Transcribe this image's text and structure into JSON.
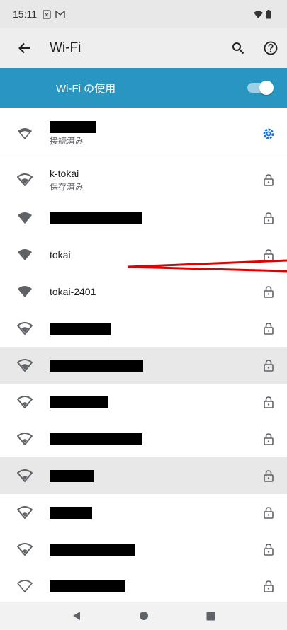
{
  "status_bar": {
    "time": "15:11"
  },
  "app_bar": {
    "title": "Wi-Fi"
  },
  "master_switch": {
    "label": "Wi-Fi の使用",
    "enabled": true,
    "accent": "#2896c0"
  },
  "networks": [
    {
      "name": "",
      "status": "接続済み",
      "redacted": true,
      "secured": false,
      "connected": true,
      "signal": "full-outline"
    },
    {
      "name": "k-tokai",
      "status": "保存済み",
      "redacted": false,
      "secured": true,
      "signal": "outline"
    },
    {
      "name": "",
      "redacted": true,
      "secured": true,
      "signal": "full"
    },
    {
      "name": "tokai",
      "redacted": false,
      "secured": true,
      "signal": "full"
    },
    {
      "name": "tokai-2401",
      "redacted": false,
      "secured": true,
      "signal": "full"
    },
    {
      "name": "",
      "redacted": true,
      "secured": true,
      "signal": "outline"
    },
    {
      "name": "",
      "redacted": true,
      "secured": true,
      "signal": "outline",
      "highlighted": true
    },
    {
      "name": "",
      "redacted": true,
      "secured": true,
      "signal": "outline"
    },
    {
      "name": "",
      "redacted": true,
      "secured": true,
      "signal": "outline"
    },
    {
      "name": "",
      "redacted": true,
      "secured": true,
      "signal": "outline",
      "highlighted": true
    },
    {
      "name": "",
      "redacted": true,
      "secured": true,
      "signal": "outline"
    },
    {
      "name": "",
      "redacted": true,
      "secured": true,
      "signal": "outline"
    },
    {
      "name": "",
      "redacted": true,
      "secured": true,
      "signal": "weak"
    }
  ],
  "icons": {
    "back": "arrow-back-icon",
    "search": "search-icon",
    "help": "help-icon",
    "settings": "gear-icon",
    "lock": "lock-icon",
    "wifi": "wifi-signal-icon"
  },
  "colors": {
    "annotation": "#e00000"
  }
}
